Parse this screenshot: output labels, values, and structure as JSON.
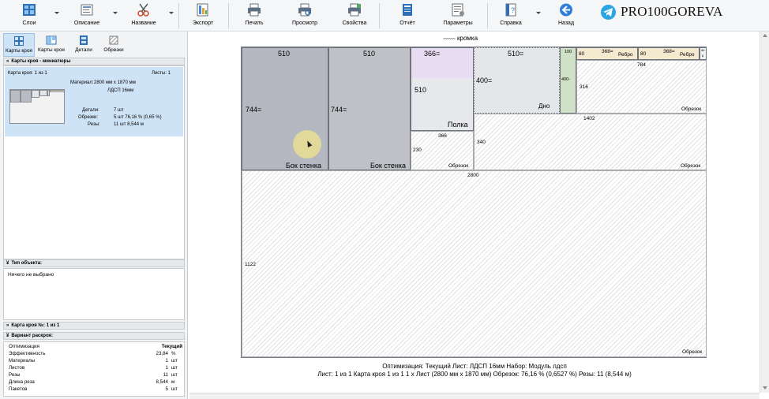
{
  "toolbar": {
    "layers": "Слои",
    "description": "Описание",
    "name": "Название",
    "export": "Экспорт",
    "print": "Печать",
    "preview": "Просмотр",
    "properties": "Свойства",
    "report": "Отчёт",
    "parameters": "Параметры",
    "help": "Справка",
    "back": "Назад"
  },
  "brand": {
    "text": "PRO100GOREVA",
    "color": "#2ca5e0"
  },
  "left_panel": {
    "subtabs": [
      "Карты кроя",
      "Карты кроя",
      "Детали",
      "Обрезки"
    ],
    "miniatures_header": "Карты кроя - миниатюры",
    "card": {
      "title": "Карта кроя: 1 из 1",
      "sheets": "Листы: 1",
      "material_label": "Материал:",
      "material_value": "2800 мм x 1870 мм",
      "material_name": "ЛДСП 16мм",
      "details_label": "Детали:",
      "details_value": "7 шт",
      "offcuts_label": "Обрезки:",
      "offcuts_value": "5 шт 76,16 % (0,65 %)",
      "cuts_label": "Резы:",
      "cuts_value": "11 шт 8,544 м"
    },
    "object_type_header": "Тип объекта:",
    "object_type_value": "Ничего не выбрано",
    "cut_map_header": "Карта кроя №: 1 из 1",
    "variant_header": "Вариант раскроя:",
    "stats": [
      {
        "label": "Оптимизация",
        "value": "Текущий",
        "unit": ""
      },
      {
        "label": "Эффективность",
        "value": "23,84",
        "unit": "%"
      },
      {
        "label": "Материалы",
        "value": "1",
        "unit": "шт"
      },
      {
        "label": "Листов",
        "value": "1",
        "unit": "шт"
      },
      {
        "label": "Резы",
        "value": "11",
        "unit": "шт"
      },
      {
        "label": "Длина реза",
        "value": "8,544",
        "unit": "м"
      },
      {
        "label": "Пакетов",
        "value": "5",
        "unit": "шт"
      }
    ]
  },
  "main": {
    "edge_label": "кромка",
    "pieces": {
      "bok1": {
        "top": "510",
        "left": "744=",
        "name": "Бок стенка"
      },
      "bok2": {
        "top": "510",
        "left": "744=",
        "name": "Бок стенка"
      },
      "polka": {
        "top": "366=",
        "left": "510",
        "name": "Полка"
      },
      "dno": {
        "top": "510=",
        "left": "400=",
        "name": "Дно"
      },
      "small": {
        "top": "100",
        "left": "400-"
      },
      "rebro1": {
        "left": "80",
        "top": "368=",
        "name": "Ребро"
      },
      "rebro2": {
        "left": "80",
        "top": "368=",
        "name": "Ребро"
      },
      "tiny": {
        "a": "4b",
        "b": "6"
      }
    },
    "offcuts": {
      "o1": {
        "top": "784",
        "left": "316",
        "name": "Обрезок"
      },
      "o2": {
        "top": "366",
        "left": "230",
        "name": "Обрезок"
      },
      "o3": {
        "top": "1402",
        "left": "340",
        "name": "Обрезок"
      },
      "o4": {
        "top": "2800",
        "left": "1122",
        "name": "Обрезок"
      }
    },
    "footer_line1": "Оптимизация: Текущий  Лист: ЛДСП 16мм  Набор: Модуль лдсп",
    "footer_line2": "Лист: 1  из 1  Карта кроя 1 из 1   1 х Лист (2800 мм х 1870 мм)  Обрезок: 76,16 % (0,6527 %)  Резы: 11 (8,544 м)"
  }
}
